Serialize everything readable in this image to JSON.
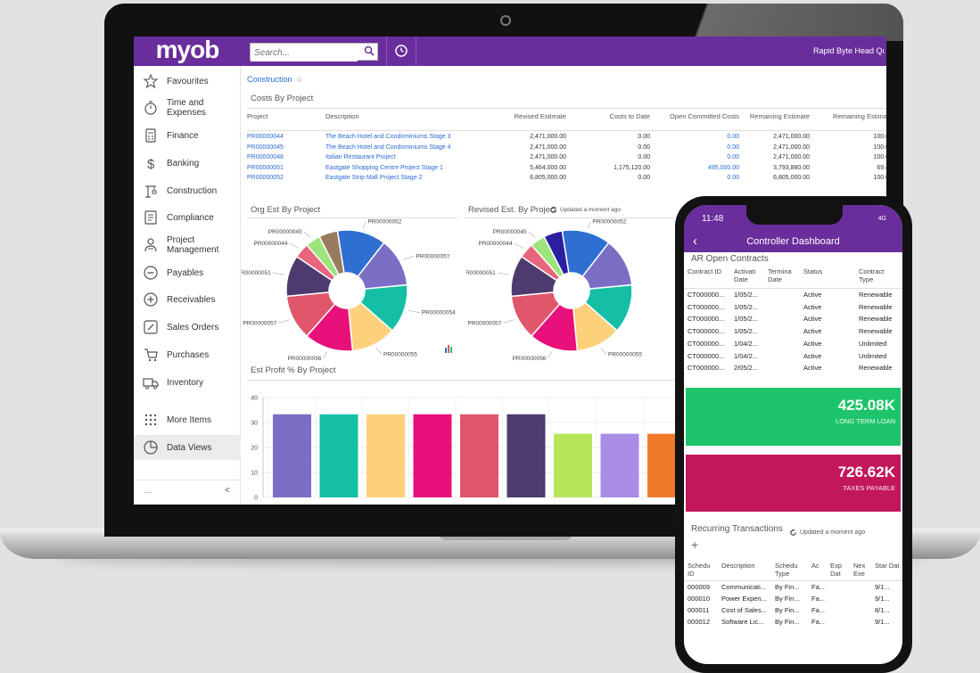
{
  "app": {
    "logo": "myob",
    "search_placeholder": "Search...",
    "branch": "Rapid Byte Head Qu"
  },
  "sidebar": {
    "items": [
      {
        "label": "Favourites",
        "icon": "star-icon"
      },
      {
        "label": "Time and Expenses",
        "icon": "stopwatch-icon"
      },
      {
        "label": "Finance",
        "icon": "calculator-icon"
      },
      {
        "label": "Banking",
        "icon": "dollar-icon"
      },
      {
        "label": "Construction",
        "icon": "crane-icon"
      },
      {
        "label": "Compliance",
        "icon": "document-icon"
      },
      {
        "label": "Project Management",
        "icon": "people-icon"
      },
      {
        "label": "Payables",
        "icon": "minus-circle-icon"
      },
      {
        "label": "Receivables",
        "icon": "plus-circle-icon"
      },
      {
        "label": "Sales Orders",
        "icon": "edit-icon"
      },
      {
        "label": "Purchases",
        "icon": "cart-icon"
      },
      {
        "label": "Inventory",
        "icon": "truck-icon"
      },
      {
        "label": "More Items",
        "icon": "grid-icon"
      },
      {
        "label": "Data Views",
        "icon": "pie-icon"
      }
    ],
    "footer_dots": "...",
    "footer_collapse": "<"
  },
  "breadcrumb": "Construction",
  "costs": {
    "title": "Costs By Project",
    "headers": [
      "Project",
      "Description",
      "Revised Estimate",
      "Costs to Date",
      "Open Committed Costs",
      "Remaining Estimate",
      "Remaining Estimat"
    ],
    "rows": [
      [
        "PR00000044",
        "The Beach Hotel and Condominiums Stage 3",
        "2,471,000.00",
        "0.00",
        "0.00",
        "2,471,000.00",
        "100.0"
      ],
      [
        "PR00000045",
        "The Beach Hotel and Condominiums Stage 4",
        "2,471,000.00",
        "0.00",
        "0.00",
        "2,471,000.00",
        "100.0"
      ],
      [
        "PR00000048",
        "Italian Restaurant Project",
        "2,471,000.00",
        "0.00",
        "0.00",
        "2,471,000.00",
        "100.0"
      ],
      [
        "PR00000051",
        "Eastgate Shopping Centre Project Stage 1",
        "5,464,000.00",
        "1,175,120.00",
        "495,000.00",
        "3,793,880.00",
        "69.4"
      ],
      [
        "PR00000052",
        "Eastgate Strip Mall Project Stage 2",
        "6,805,000.00",
        "0.00",
        "0.00",
        "6,805,000.00",
        "100.0"
      ]
    ]
  },
  "chart_titles": {
    "org": "Org Est By Project",
    "revised": "Revised Est. By Project",
    "updated": "Updated a moment ago",
    "profit": "Est Profit % By Project"
  },
  "chart_data": [
    {
      "type": "pie",
      "title": "Org Est By Project",
      "slices": [
        {
          "label": "PR00000052",
          "value": 13,
          "color": "#2f6fd1"
        },
        {
          "label": "PR0000005?",
          "value": 13,
          "color": "#7a6fc4"
        },
        {
          "label": "PR00000054",
          "value": 13,
          "color": "#15bfa6"
        },
        {
          "label": "PR00000055",
          "value": 12,
          "color": "#fdd17c"
        },
        {
          "label": "PR00000056",
          "value": 13,
          "color": "#e8107a"
        },
        {
          "label": "PR00000057",
          "value": 12,
          "color": "#e0566b"
        },
        {
          "label": "PR00000051",
          "value": 11,
          "color": "#4d3a6e"
        },
        {
          "label": "PR00000044",
          "value": 4,
          "color": "#e8667d"
        },
        {
          "label": "PR00000045",
          "value": 4,
          "color": "#9ee47d"
        },
        {
          "label": "",
          "value": 5,
          "color": "#9a7b5d"
        }
      ]
    },
    {
      "type": "pie",
      "title": "Revised Est. By Project",
      "slices": [
        {
          "label": "PR00000052",
          "value": 13,
          "color": "#2f6fd1"
        },
        {
          "label": "",
          "value": 13,
          "color": "#7a6fc4"
        },
        {
          "label": "",
          "value": 13,
          "color": "#15bfa6"
        },
        {
          "label": "PR00000055",
          "value": 12,
          "color": "#fdd17c"
        },
        {
          "label": "PR00000056",
          "value": 13,
          "color": "#e8107a"
        },
        {
          "label": "PR00000057",
          "value": 12,
          "color": "#e0566b"
        },
        {
          "label": "PR00000051",
          "value": 11,
          "color": "#4d3a6e"
        },
        {
          "label": "PR00000044",
          "value": 4,
          "color": "#e8667d"
        },
        {
          "label": "PR00000045",
          "value": 4,
          "color": "#9ee47d"
        },
        {
          "label": "",
          "value": 5,
          "color": "#2a1fa0"
        }
      ]
    },
    {
      "type": "bar",
      "title": "Est Profit % By Project",
      "ylim": [
        0,
        40
      ],
      "yticks": [
        0,
        10,
        20,
        30,
        40
      ],
      "values": [
        33.3,
        33.3,
        33.3,
        33.3,
        33.3,
        33.3,
        25.5,
        25.5,
        25.5
      ],
      "colors": [
        "#7a6fc4",
        "#15bfa6",
        "#fdd17c",
        "#e8107a",
        "#e0566b",
        "#4d3a6e",
        "#b8e65a",
        "#a98ce6",
        "#f07a2a"
      ]
    }
  ],
  "phone": {
    "time": "11:48",
    "battery": "4G",
    "title": "Controller Dashboard",
    "ar_title": "AR Open Contracts",
    "ar_headers": [
      "Contract ID",
      "Activati Date",
      "Termina Date",
      "Status",
      "Contract Type"
    ],
    "ar_rows": [
      [
        "CT000000...",
        "1/05/2...",
        "",
        "Active",
        "Renewable"
      ],
      [
        "CT000000...",
        "1/05/2...",
        "",
        "Active",
        "Renewable"
      ],
      [
        "CT000000...",
        "1/05/2...",
        "",
        "Active",
        "Renewable"
      ],
      [
        "CT000000...",
        "1/05/2...",
        "",
        "Active",
        "Renewable"
      ],
      [
        "CT000000...",
        "1/04/2...",
        "",
        "Active",
        "Unlimited"
      ],
      [
        "CT000000...",
        "1/04/2...",
        "",
        "Active",
        "Unlimited"
      ],
      [
        "CT000000...",
        "2/05/2...",
        "",
        "Active",
        "Renewable"
      ]
    ],
    "tile1": {
      "value": "425.08K",
      "label": "LONG TERM LOAN",
      "color": "#1ec46b"
    },
    "tile2": {
      "value": "726.62K",
      "label": "TAXES PAYABLE",
      "color": "#c2185b"
    },
    "rec_title": "Recurring Transactions",
    "rec_updated": "Updated a moment ago",
    "rec_add": "+",
    "rec_headers": [
      "Schedu ID",
      "Description",
      "Schedu Type",
      "Ac",
      "Exp Dat",
      "Nex Exe",
      "Star Dat"
    ],
    "rec_rows": [
      [
        "000009",
        "Communicati...",
        "By Fin...",
        "Fa...",
        "",
        "",
        "9/1..."
      ],
      [
        "000010",
        "Power Expen...",
        "By Fin...",
        "Fa...",
        "",
        "",
        "9/1..."
      ],
      [
        "000011",
        "Cost of Sales...",
        "By Fin...",
        "Fa...",
        "",
        "",
        "8/1..."
      ],
      [
        "000012",
        "Software Lic...",
        "By Fin...",
        "Fa...",
        "",
        "",
        "9/1..."
      ]
    ]
  }
}
